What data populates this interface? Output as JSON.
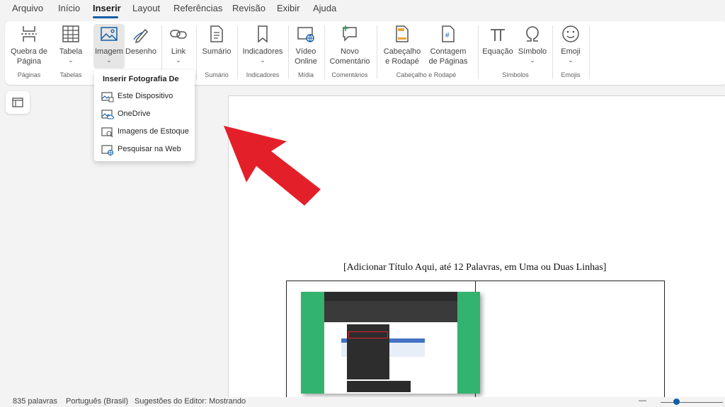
{
  "menu": {
    "tabs": [
      "Arquivo",
      "Início",
      "Inserir",
      "Layout",
      "Referências",
      "Revisão",
      "Exibir",
      "Ajuda"
    ],
    "active": "Inserir"
  },
  "ribbon": {
    "buttons": {
      "page_break": "Quebra de Página",
      "table": "Tabela",
      "image": "Imagem",
      "drawing": "Desenho",
      "link": "Link",
      "toc": "Sumário",
      "bookmarks": "Indicadores",
      "online_video": "Vídeo Online",
      "new_comment": "Novo Comentário",
      "header_footer": "Cabeçalho e Rodapé",
      "page_count": "Contagem de Páginas",
      "equation": "Equação",
      "symbol": "Símbolo",
      "emoji": "Emoji"
    },
    "groups": {
      "pages": "Páginas",
      "tables": "Tabelas",
      "toc": "Sumário",
      "bookmarks": "Indicadores",
      "media": "Mídia",
      "comments": "Comentários",
      "header_footer": "Cabeçalho e Rodapé",
      "symbols": "Símbolos",
      "emojis": "Emojis"
    }
  },
  "dropdown": {
    "title": "Inserir Fotografia De",
    "items": [
      "Este Dispositivo",
      "OneDrive",
      "Imagens de Estoque",
      "Pesquisar na Web"
    ]
  },
  "document": {
    "title": "[Adicionar Título Aqui, até 12 Palavras, em Uma ou Duas Linhas]"
  },
  "status": {
    "words": "835 palavras",
    "language": "Português (Brasil)",
    "editor": "Sugestões do Editor: Mostrando"
  },
  "colors": {
    "accent": "#115ea3",
    "arrow": "#e3202a",
    "screenshot_bg": "#32b36f"
  }
}
